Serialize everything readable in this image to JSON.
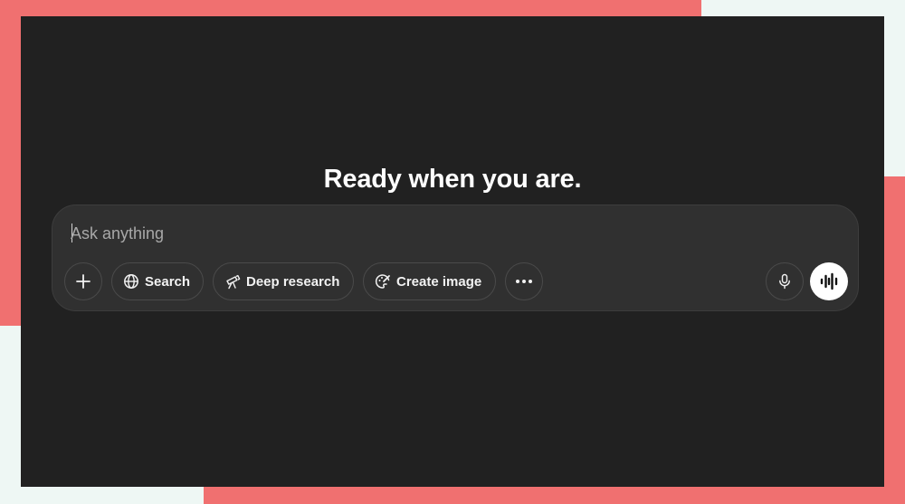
{
  "headline": "Ready when you are.",
  "composer": {
    "placeholder": "Ask anything",
    "value": ""
  },
  "toolbar": {
    "add": {
      "icon": "plus-icon"
    },
    "search": {
      "label": "Search",
      "icon": "globe-icon"
    },
    "deep_research": {
      "label": "Deep research",
      "icon": "telescope-icon"
    },
    "create_image": {
      "label": "Create image",
      "icon": "palette-icon"
    },
    "more": {
      "icon": "ellipsis-icon"
    },
    "dictate": {
      "icon": "microphone-icon"
    },
    "voice_mode": {
      "icon": "waveform-icon"
    }
  },
  "colors": {
    "window_bg": "#212121",
    "composer_bg": "#303030",
    "text": "#ffffff",
    "placeholder": "#a8a8a8",
    "decoration": "#f07070",
    "page_bg": "#eef7f4"
  }
}
